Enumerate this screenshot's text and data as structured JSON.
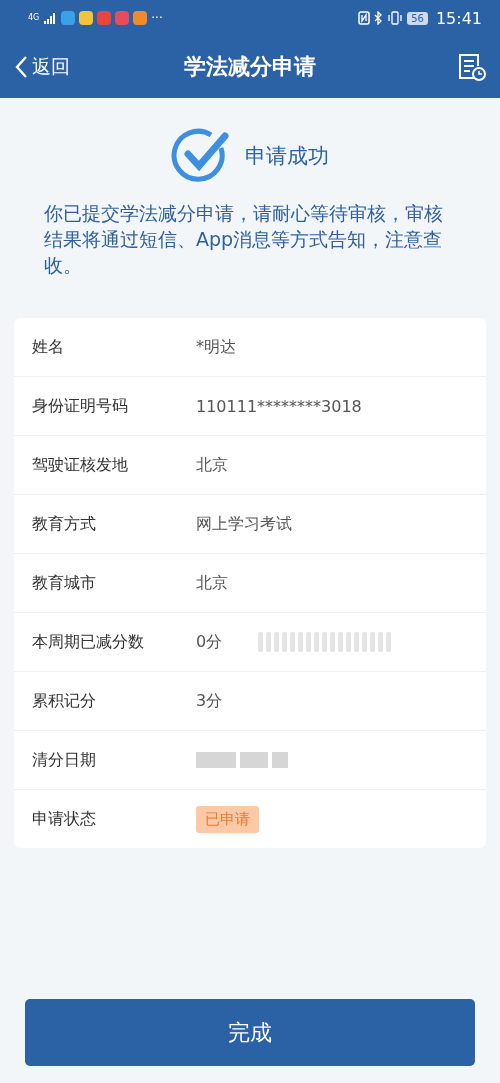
{
  "status_bar": {
    "network": "4G",
    "more": "···",
    "battery": "56",
    "time": "15:41"
  },
  "header": {
    "back": "返回",
    "title": "学法减分申请"
  },
  "result": {
    "title": "申请成功",
    "message": "你已提交学法减分申请，请耐心等待审核，审核结果将通过短信、App消息等方式告知，注意查收。"
  },
  "details": [
    {
      "label": "姓名",
      "value": "*明达",
      "kind": "text"
    },
    {
      "label": "身份证明号码",
      "value": "110111********3018",
      "kind": "text"
    },
    {
      "label": "驾驶证核发地",
      "value": "北京",
      "kind": "text"
    },
    {
      "label": "教育方式",
      "value": "网上学习考试",
      "kind": "text"
    },
    {
      "label": "教育城市",
      "value": "北京",
      "kind": "text"
    },
    {
      "label": "本周期已减分数",
      "value": "0分",
      "kind": "text_redacted"
    },
    {
      "label": "累积记分",
      "value": "3分",
      "kind": "text"
    },
    {
      "label": "清分日期",
      "kind": "redacted"
    },
    {
      "label": "申请状态",
      "value": "已申请",
      "kind": "badge"
    }
  ],
  "done_button": "完成"
}
